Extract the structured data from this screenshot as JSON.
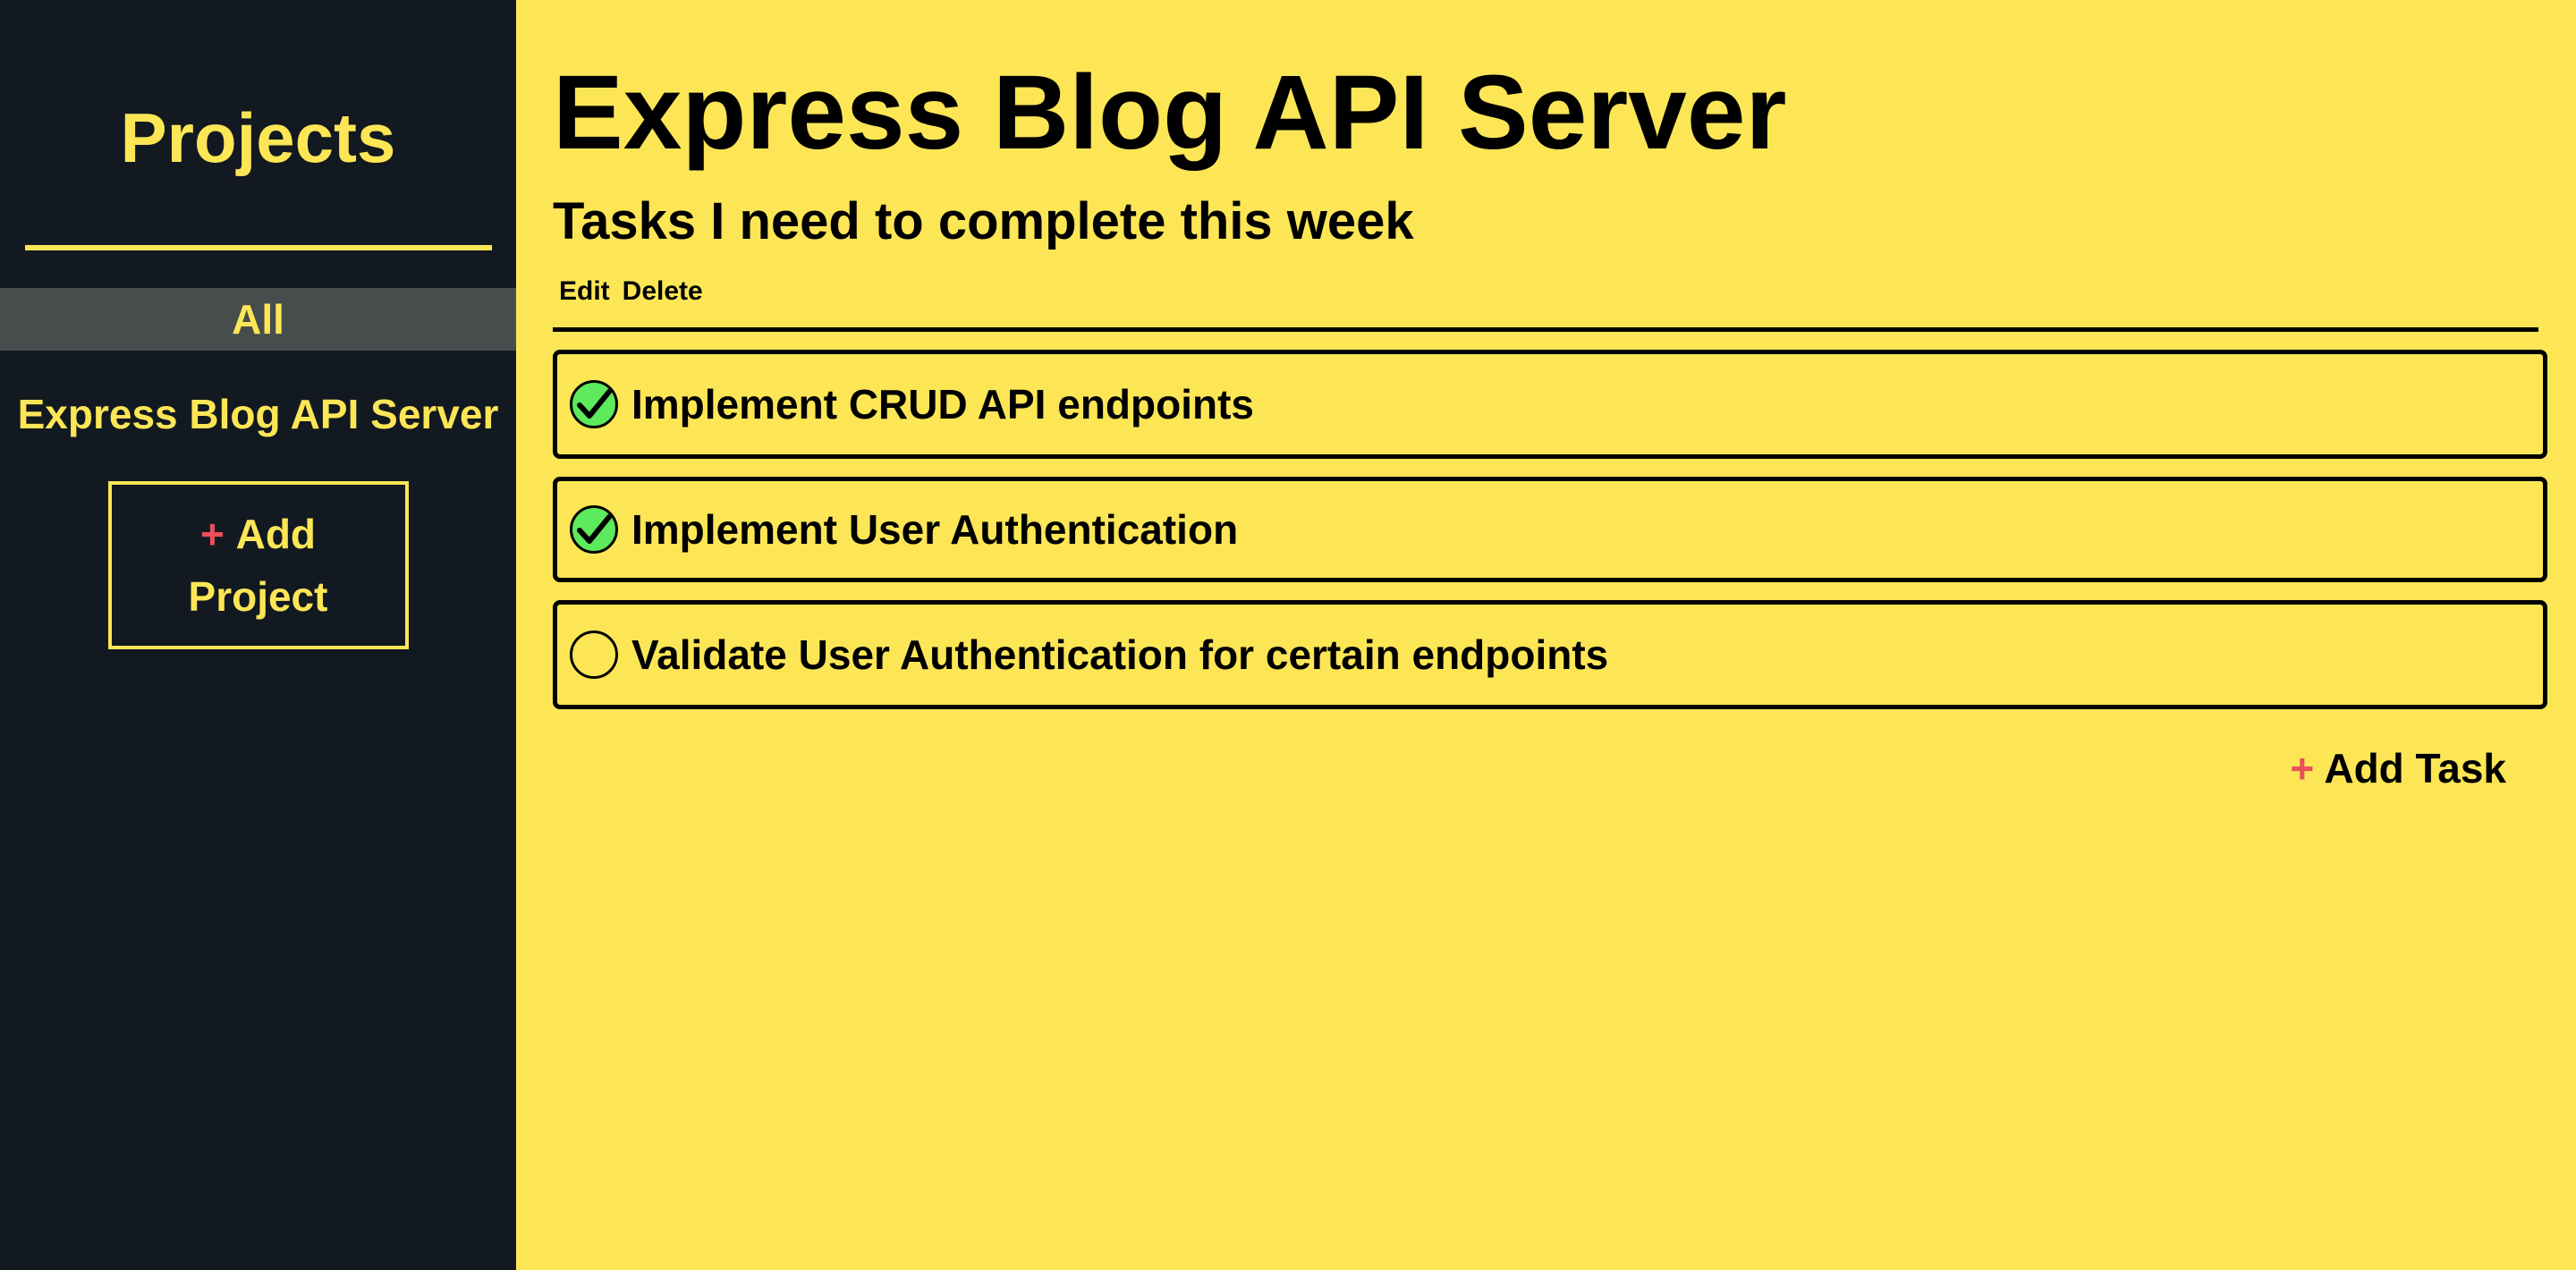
{
  "sidebar": {
    "title": "Projects",
    "all_label": "All",
    "projects": [
      "Express Blog API Server"
    ],
    "add_project": {
      "plus": "+",
      "line1": "Add",
      "line2": "Project"
    }
  },
  "main": {
    "title": "Express Blog API Server",
    "subtitle": "Tasks I need to complete this week",
    "actions": {
      "edit": "Edit",
      "delete": "Delete"
    },
    "tasks": [
      {
        "label": "Implement CRUD API endpoints",
        "done": true
      },
      {
        "label": "Implement User Authentication",
        "done": true
      },
      {
        "label": "Validate User Authentication for certain endpoints",
        "done": false
      }
    ],
    "add_task": {
      "plus": "+",
      "label": "Add Task"
    }
  },
  "colors": {
    "sidebar_bg": "#131920",
    "accent_yellow": "#fce656",
    "check_green": "#5dea5d",
    "plus_red": "#e8505b"
  }
}
